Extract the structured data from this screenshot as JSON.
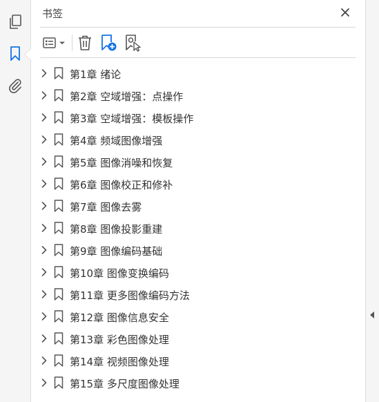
{
  "panel": {
    "title": "书签",
    "close_icon": "close-icon"
  },
  "toolbar": {
    "buttons": [
      {
        "icon": "options-list-icon"
      },
      {
        "icon": "trash-icon"
      },
      {
        "icon": "add-bookmark-icon"
      },
      {
        "icon": "bookmark-cursor-icon"
      }
    ]
  },
  "rail": {
    "items": [
      {
        "icon": "pages-icon"
      },
      {
        "icon": "bookmark-icon"
      },
      {
        "icon": "attachment-icon"
      }
    ]
  },
  "bookmarks": [
    {
      "label": "第1章  绪论"
    },
    {
      "label": "第2章  空域增强：点操作"
    },
    {
      "label": "第3章  空域增强：模板操作"
    },
    {
      "label": "第4章  频域图像增强"
    },
    {
      "label": "第5章  图像消噪和恢复"
    },
    {
      "label": "第6章  图像校正和修补"
    },
    {
      "label": "第7章  图像去雾"
    },
    {
      "label": "第8章  图像投影重建"
    },
    {
      "label": "第9章  图像编码基础"
    },
    {
      "label": "第10章  图像变换编码"
    },
    {
      "label": "第11章  更多图像编码方法"
    },
    {
      "label": "第12章  图像信息安全"
    },
    {
      "label": "第13章  彩色图像处理"
    },
    {
      "label": "第14章  视频图像处理"
    },
    {
      "label": "第15章  多尺度图像处理"
    }
  ],
  "colors": {
    "accent": "#1473e6",
    "icon": "#555555"
  }
}
